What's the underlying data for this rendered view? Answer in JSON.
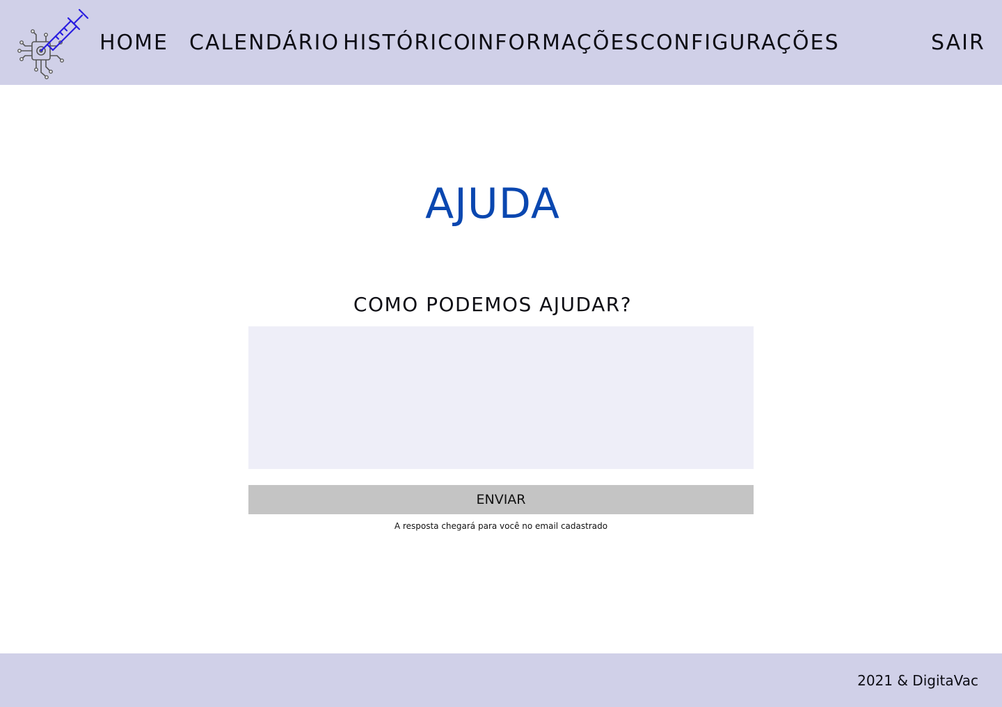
{
  "nav": {
    "home": "HOME",
    "calendario": "CALENDÁRIO",
    "historico": "HISTÓRICO",
    "informacoes": "INFORMAÇÕES",
    "configuracoes": "CONFIGURAÇÕES",
    "sair": "SAIR"
  },
  "logo": {
    "icon": "syringe-circuit-icon",
    "colors": {
      "syringe": "#2a1ee0",
      "circuit": "#555555"
    }
  },
  "main": {
    "title": "AJUDA",
    "question": "COMO PODEMOS AJUDAR?",
    "message_value": "",
    "send_label": "ENVIAR",
    "note": "A resposta chegará para você no email cadastrado"
  },
  "footer": {
    "copyright": "2021 & DigitaVac"
  },
  "colors": {
    "header_bg": "#d0d0e8",
    "footer_bg": "#d0d0e8",
    "title": "#0a47b0",
    "textarea_bg": "#eeeef8",
    "button_bg": "#c4c4c4"
  }
}
